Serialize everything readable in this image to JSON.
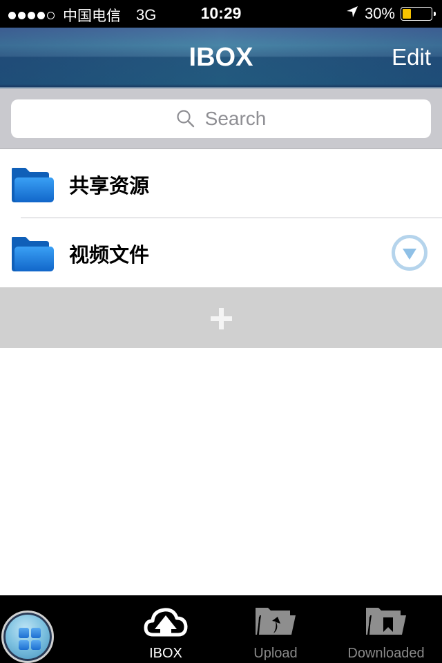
{
  "status_bar": {
    "signal_filled": 4,
    "signal_total": 5,
    "carrier": "中国电信",
    "network": "3G",
    "time": "10:29",
    "battery_percent_label": "30%",
    "battery_level": 0.3,
    "battery_color": "#f7c300",
    "location_icon": "location-arrow-icon"
  },
  "nav_bar": {
    "title": "IBOX",
    "edit_label": "Edit"
  },
  "search": {
    "placeholder": "Search",
    "value": ""
  },
  "list": {
    "items": [
      {
        "label": "共享资源",
        "icon": "folder-icon",
        "has_disclosure": false
      },
      {
        "label": "视频文件",
        "icon": "folder-icon",
        "has_disclosure": true
      }
    ],
    "add_icon": "plus-icon"
  },
  "tab_bar": {
    "home_icon": "grid-icon",
    "tabs": [
      {
        "label": "IBOX",
        "icon": "cloud-upload-icon",
        "active": true
      },
      {
        "label": "Upload",
        "icon": "folder-upload-icon",
        "active": false
      },
      {
        "label": "Downloaded",
        "icon": "folder-bookmark-icon",
        "active": false
      }
    ]
  },
  "colors": {
    "nav_bar": "#2a5f85",
    "folder_blue": "#1f86e0",
    "disclosure": "#b5d4ec",
    "add_row_bg": "#d0d0d0",
    "search_bg": "#c9c9ce"
  }
}
